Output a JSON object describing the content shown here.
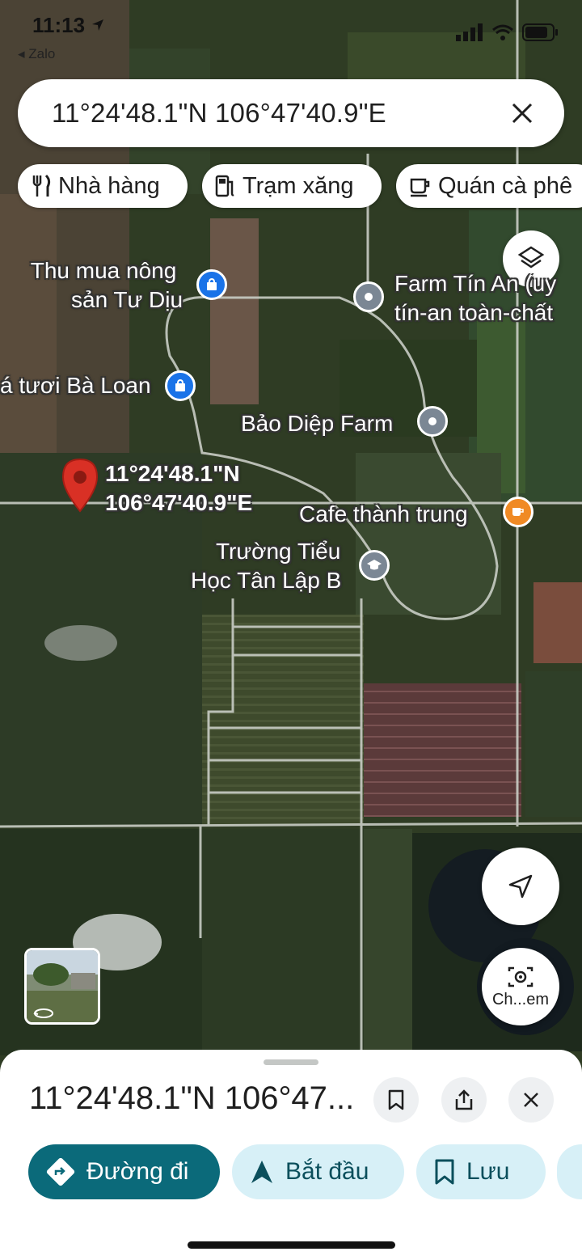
{
  "status_bar": {
    "time": "11:13",
    "back_app": "◂ Zalo"
  },
  "search": {
    "query": "11°24'48.1\"N 106°47'40.9\"E"
  },
  "chips": [
    {
      "icon": "restaurant-icon",
      "label": "Nhà hàng"
    },
    {
      "icon": "gas-station-icon",
      "label": "Trạm xăng"
    },
    {
      "icon": "coffee-icon",
      "label": "Quán cà phê"
    }
  ],
  "map": {
    "dropped_pin": {
      "line1": "11°24'48.1\"N",
      "line2": "106°47'40.9\"E",
      "color": "#d93025"
    },
    "places": [
      {
        "line1": "Thu mua nông",
        "line2": "sản Tư Dịu",
        "icon": "shopping-bag-icon",
        "color": "#1a73e8"
      },
      {
        "line1": "Farm Tín An (uy",
        "line2": "tín-an toàn-chất",
        "icon": "place-icon",
        "color": "#7b8794"
      },
      {
        "line1": "á tươi Bà Loan",
        "icon": "shopping-bag-icon",
        "color": "#1a73e8"
      },
      {
        "line1": "Bảo Diệp Farm",
        "icon": "place-icon",
        "color": "#7b8794"
      },
      {
        "line1": "Cafe thành trung",
        "icon": "coffee-icon",
        "color": "#f08a24"
      },
      {
        "line1": "Trường Tiểu",
        "line2": "Học Tân Lập B",
        "icon": "school-icon",
        "color": "#7b8794"
      }
    ],
    "street_view_button": "Ch...em"
  },
  "sheet": {
    "title": "11°24'48.1\"N 106°47...",
    "actions": [
      {
        "label": "Đường đi",
        "icon": "directions-icon"
      },
      {
        "label": "Bắt đầu",
        "icon": "navigation-icon"
      },
      {
        "label": "Lưu",
        "icon": "bookmark-icon"
      }
    ]
  }
}
